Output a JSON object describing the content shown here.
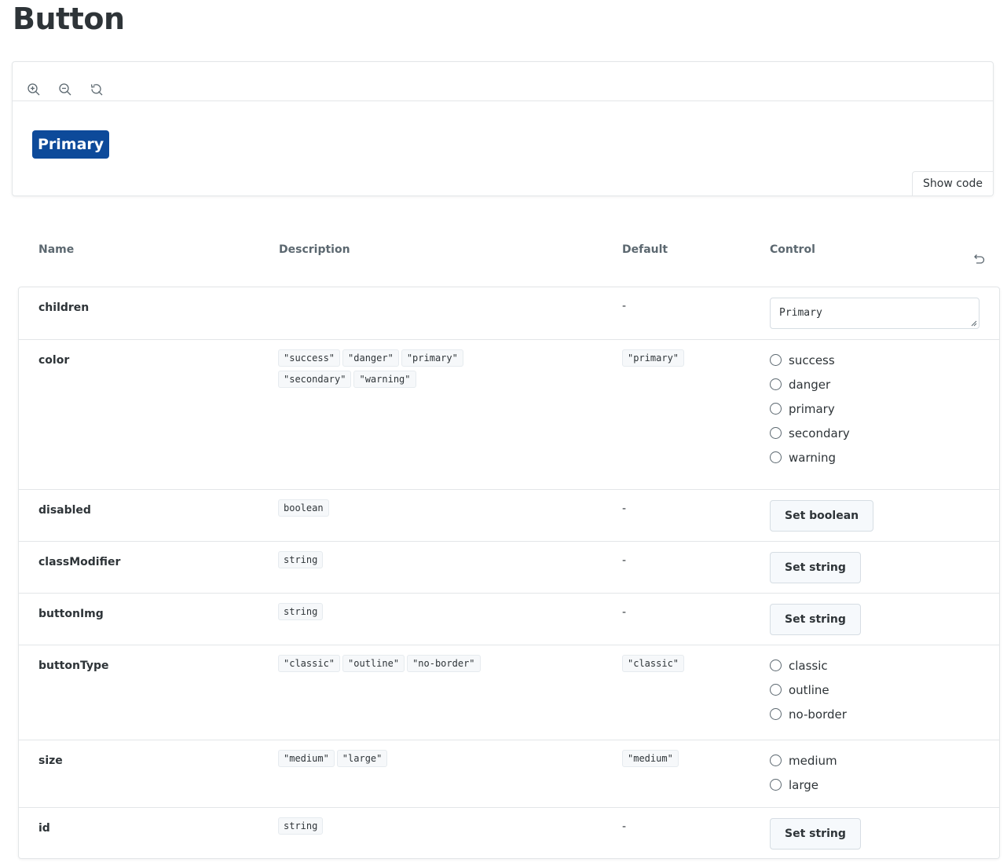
{
  "page": {
    "title": "Button"
  },
  "preview": {
    "toolbar": [
      {
        "name": "zoom-in-icon"
      },
      {
        "name": "zoom-out-icon"
      },
      {
        "name": "reset-zoom-icon"
      }
    ],
    "demo_button_label": "Primary",
    "demo_button_color": "#0d4a9a",
    "show_code_label": "Show code"
  },
  "table": {
    "headers": {
      "name": "Name",
      "description": "Description",
      "default": "Default",
      "control": "Control"
    },
    "reset_icon": "undo-icon",
    "rows": [
      {
        "name": "children",
        "description": [],
        "default": "-",
        "control": {
          "type": "text",
          "value": "Primary"
        }
      },
      {
        "name": "color",
        "description": [
          "\"success\"",
          "\"danger\"",
          "\"primary\"",
          "\"secondary\"",
          "\"warning\""
        ],
        "default": "\"primary\"",
        "control": {
          "type": "radio",
          "options": [
            "success",
            "danger",
            "primary",
            "secondary",
            "warning"
          ]
        }
      },
      {
        "name": "disabled",
        "description": [
          "boolean"
        ],
        "default": "-",
        "control": {
          "type": "button",
          "label": "Set boolean"
        }
      },
      {
        "name": "classModifier",
        "description": [
          "string"
        ],
        "default": "-",
        "control": {
          "type": "button",
          "label": "Set string"
        }
      },
      {
        "name": "buttonImg",
        "description": [
          "string"
        ],
        "default": "-",
        "control": {
          "type": "button",
          "label": "Set string"
        }
      },
      {
        "name": "buttonType",
        "description": [
          "\"classic\"",
          "\"outline\"",
          "\"no-border\""
        ],
        "default": "\"classic\"",
        "control": {
          "type": "radio",
          "options": [
            "classic",
            "outline",
            "no-border"
          ]
        }
      },
      {
        "name": "size",
        "description": [
          "\"medium\"",
          "\"large\""
        ],
        "default": "\"medium\"",
        "control": {
          "type": "radio",
          "options": [
            "medium",
            "large"
          ]
        }
      },
      {
        "name": "id",
        "description": [
          "string"
        ],
        "default": "-",
        "control": {
          "type": "button",
          "label": "Set string"
        }
      }
    ]
  }
}
